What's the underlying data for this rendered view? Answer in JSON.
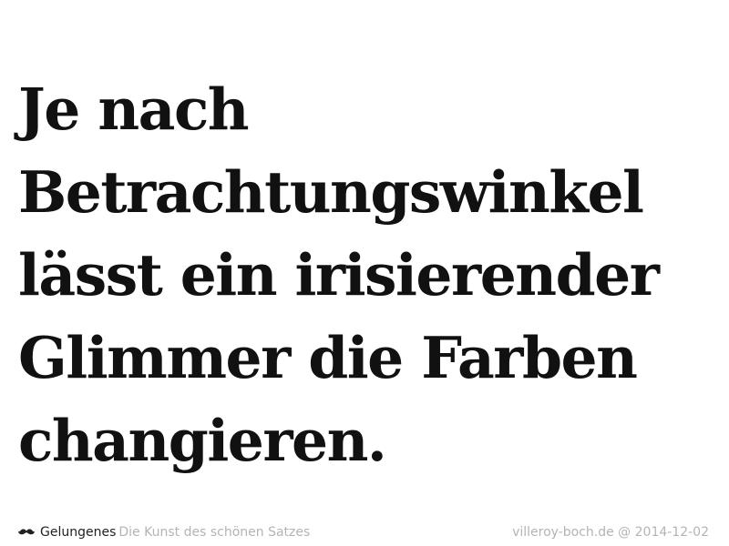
{
  "quote": {
    "lines": [
      "Je nach",
      "Betrachtungswinkel",
      "lässt ein irisierender",
      "Glimmer die Farben",
      "changieren."
    ]
  },
  "footer": {
    "icon": "mustache-icon",
    "brand": "Gelungenes",
    "tagline": "Die Kunst des schönen Satzes",
    "source": "villeroy-boch.de",
    "separator": "@",
    "date": "2014-12-02"
  },
  "colors": {
    "text": "#111111",
    "brand": "#222222",
    "muted": "#b4b4b4",
    "background": "#ffffff"
  }
}
